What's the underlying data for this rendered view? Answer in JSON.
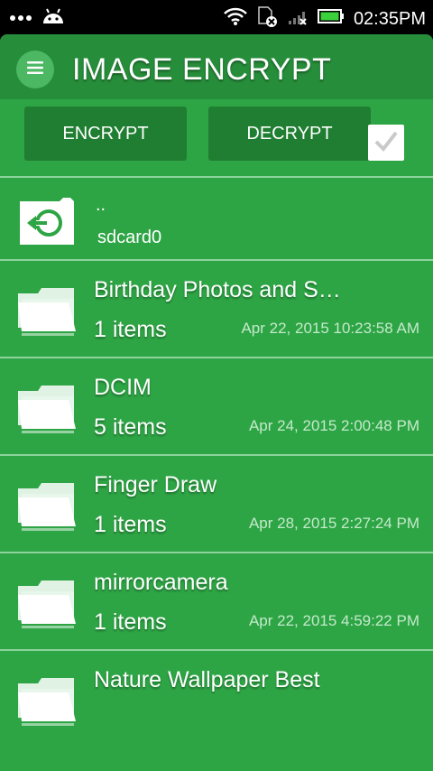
{
  "status_bar": {
    "time": "02:35PM",
    "icons": [
      "more-dots-icon",
      "android-icon",
      "wifi-icon",
      "no-sim-icon",
      "signal-icon",
      "battery-icon"
    ]
  },
  "toolbar": {
    "title": "IMAGE ENCRYPT",
    "menu_icon": "hamburger-menu-icon"
  },
  "actions": {
    "encrypt_label": "ENCRYPT",
    "decrypt_label": "DECRYPT",
    "select_all_checked": true
  },
  "up_item": {
    "dots": "..",
    "path": "sdcard0",
    "icon": "sd-card-back-icon"
  },
  "folders": [
    {
      "name": "Birthday Photos and S…",
      "count": "1 items",
      "date": "Apr 22, 2015 10:23:58 AM"
    },
    {
      "name": "DCIM",
      "count": "5 items",
      "date": "Apr 24, 2015 2:00:48 PM"
    },
    {
      "name": "Finger Draw",
      "count": "1 items",
      "date": "Apr 28, 2015 2:27:24 PM"
    },
    {
      "name": "mirrorcamera",
      "count": "1 items",
      "date": "Apr 22, 2015 4:59:22 PM"
    },
    {
      "name": "Nature Wallpaper Best",
      "count": "",
      "date": ""
    }
  ],
  "colors": {
    "app_background": "#2ea545",
    "toolbar": "#268d3a",
    "button": "#1f7e31",
    "divider": "#8dd39c",
    "date_text": "#c3e9cb"
  }
}
